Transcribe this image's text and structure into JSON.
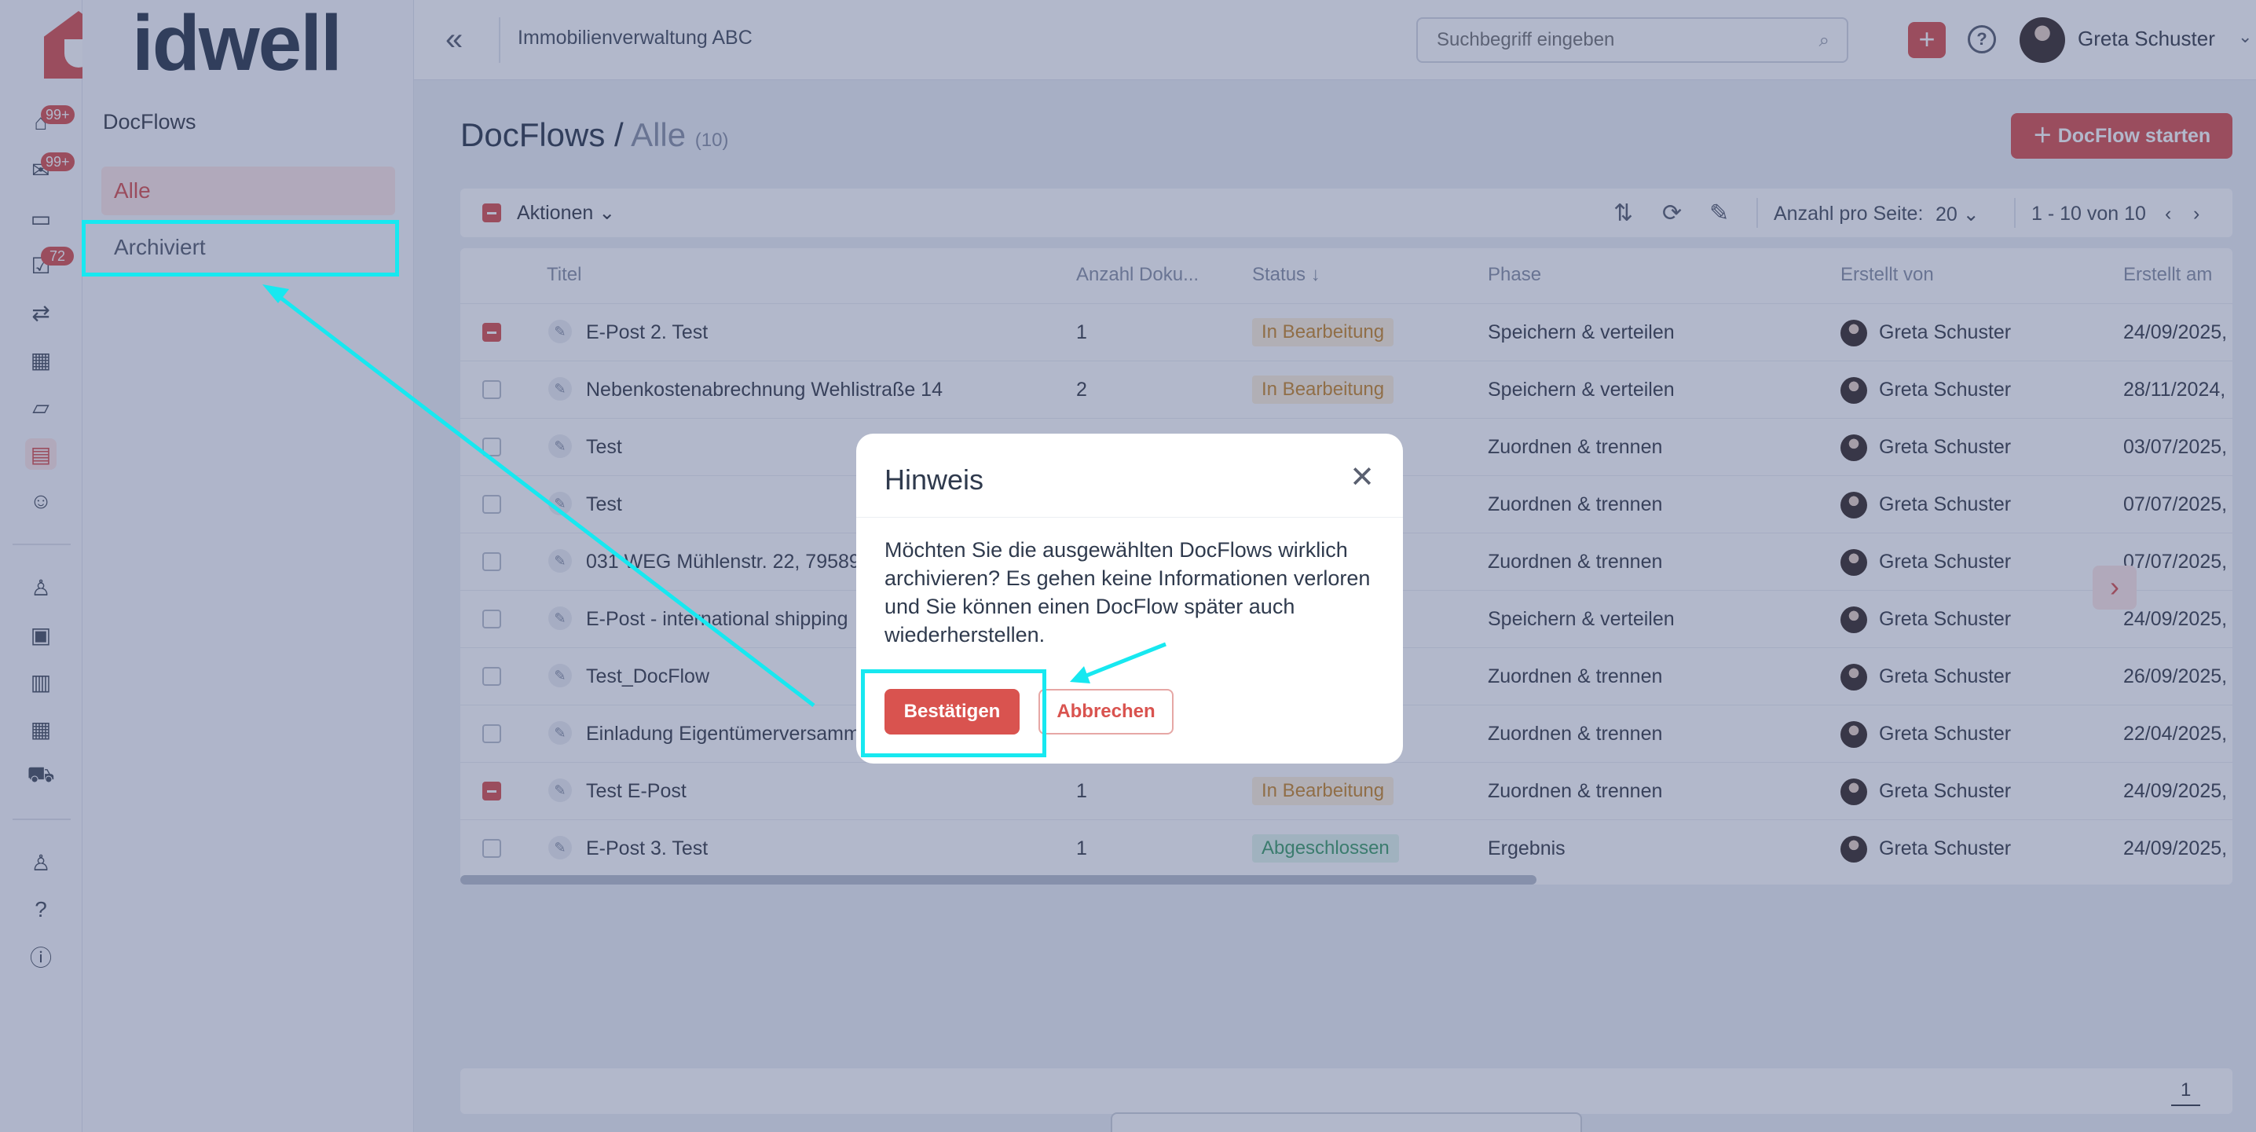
{
  "brand": {
    "name": "idwell"
  },
  "rail": {
    "badges": [
      "99+",
      "99+",
      "72"
    ]
  },
  "subnav": {
    "title": "DocFlows",
    "items": [
      {
        "label": "Alle",
        "active": true
      },
      {
        "label": "Archiviert",
        "active": false
      }
    ]
  },
  "topbar": {
    "org": "Immobilienverwaltung ABC",
    "search_placeholder": "Suchbegriff eingeben",
    "user_name": "Greta Schuster"
  },
  "page": {
    "title": "DocFlows",
    "separator": "/",
    "subtitle": "Alle",
    "count": "(10)",
    "start_button": "DocFlow starten"
  },
  "toolbar": {
    "actions_label": "Aktionen",
    "per_page_label": "Anzahl pro Seite:",
    "per_page_value": "20",
    "range": "1 - 10 von 10"
  },
  "table": {
    "columns": [
      "Titel",
      "Anzahl Doku...",
      "Status",
      "Phase",
      "Erstellt von",
      "Erstellt am"
    ],
    "rows": [
      {
        "checked": true,
        "title": "E-Post 2. Test",
        "count": "1",
        "status": "In Bearbeitung",
        "phase": "Speichern & verteilen",
        "creator": "Greta Schuster",
        "date": "24/09/2025,"
      },
      {
        "checked": false,
        "title": "Nebenkostenabrechnung Wehlistraße 14",
        "count": "2",
        "status": "In Bearbeitung",
        "phase": "Speichern & verteilen",
        "creator": "Greta Schuster",
        "date": "28/11/2024,"
      },
      {
        "checked": false,
        "title": "Test",
        "count": "",
        "status": "",
        "phase": "Zuordnen & trennen",
        "creator": "Greta Schuster",
        "date": "03/07/2025,"
      },
      {
        "checked": false,
        "title": "Test",
        "count": "",
        "status": "",
        "phase": "Zuordnen & trennen",
        "creator": "Greta Schuster",
        "date": "07/07/2025,"
      },
      {
        "checked": false,
        "title": "031 WEG Mühlenstr. 22, 79589",
        "count": "",
        "status": "",
        "phase": "Zuordnen & trennen",
        "creator": "Greta Schuster",
        "date": "07/07/2025,"
      },
      {
        "checked": false,
        "title": "E-Post - international shipping",
        "count": "",
        "status": "",
        "phase": "Speichern & verteilen",
        "creator": "Greta Schuster",
        "date": "24/09/2025,"
      },
      {
        "checked": false,
        "title": "Test_DocFlow",
        "count": "",
        "status": "",
        "phase": "Zuordnen & trennen",
        "creator": "Greta Schuster",
        "date": "26/09/2025,"
      },
      {
        "checked": false,
        "title": "Einladung Eigentümerversamm",
        "count": "",
        "status": "",
        "phase": "Zuordnen & trennen",
        "creator": "Greta Schuster",
        "date": "22/04/2025,"
      },
      {
        "checked": true,
        "title": "Test E-Post",
        "count": "1",
        "status": "In Bearbeitung",
        "phase": "Zuordnen & trennen",
        "creator": "Greta Schuster",
        "date": "24/09/2025,"
      },
      {
        "checked": false,
        "title": "E-Post 3. Test",
        "count": "1",
        "status": "Abgeschlossen",
        "phase": "Ergebnis",
        "creator": "Greta Schuster",
        "date": "24/09/2025,"
      }
    ]
  },
  "footer": {
    "page": "1"
  },
  "modal": {
    "title": "Hinweis",
    "body": "Möchten Sie die ausgewählten DocFlows wirklich archivieren? Es gehen keine Informationen verloren und Sie können einen DocFlow später auch wiederherstellen.",
    "confirm": "Bestätigen",
    "cancel": "Abbrechen"
  },
  "colors": {
    "accent": "#d9534f",
    "annotation": "#17e8f0",
    "status_in_progress": "#c9882b",
    "status_done": "#3f9e6a"
  }
}
